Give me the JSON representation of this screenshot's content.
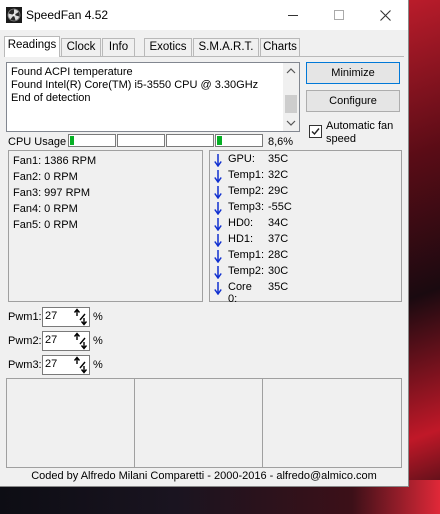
{
  "window": {
    "title": "SpeedFan 4.52",
    "controls": {
      "minimize": "─",
      "maximize": "☐",
      "close": "✕"
    }
  },
  "tabs": [
    {
      "label": "Readings",
      "active": true
    },
    {
      "label": "Clock"
    },
    {
      "label": "Info"
    },
    {
      "label": "Exotics"
    },
    {
      "label": "S.M.A.R.T."
    },
    {
      "label": "Charts"
    }
  ],
  "log": [
    "Found ACPI temperature",
    "Found Intel(R) Core(TM) i5-3550 CPU @ 3.30GHz",
    "End of detection"
  ],
  "buttons": {
    "minimize": "Minimize",
    "configure": "Configure"
  },
  "auto_fan": {
    "label": "Automatic fan speed",
    "checked": true
  },
  "cpu_usage": {
    "label": "CPU Usage",
    "cores": [
      0.08,
      0.0,
      0.0,
      0.12
    ],
    "percent": "8,6%"
  },
  "fans": [
    "Fan1: 1386 RPM",
    "Fan2: 0 RPM",
    "Fan3: 997 RPM",
    "Fan4: 0 RPM",
    "Fan5: 0 RPM"
  ],
  "temps": [
    {
      "name": "GPU:",
      "value": "35C"
    },
    {
      "name": "Temp1:",
      "value": "32C"
    },
    {
      "name": "Temp2:",
      "value": "29C"
    },
    {
      "name": "Temp3:",
      "value": "-55C"
    },
    {
      "name": "HD0:",
      "value": "34C"
    },
    {
      "name": "HD1:",
      "value": "37C"
    },
    {
      "name": "Temp1:",
      "value": "28C"
    },
    {
      "name": "Temp2:",
      "value": "30C"
    },
    {
      "name": "Core 0:",
      "value": "35C"
    }
  ],
  "arrow_color": "#1030d0",
  "pwm": [
    {
      "label": "Pwm1:",
      "value": "27",
      "unit": "%"
    },
    {
      "label": "Pwm2:",
      "value": "27",
      "unit": "%"
    },
    {
      "label": "Pwm3:",
      "value": "27",
      "unit": "%"
    }
  ],
  "status": "Coded by Alfredo Milani Comparetti - 2000-2016 - alfredo@almico.com"
}
